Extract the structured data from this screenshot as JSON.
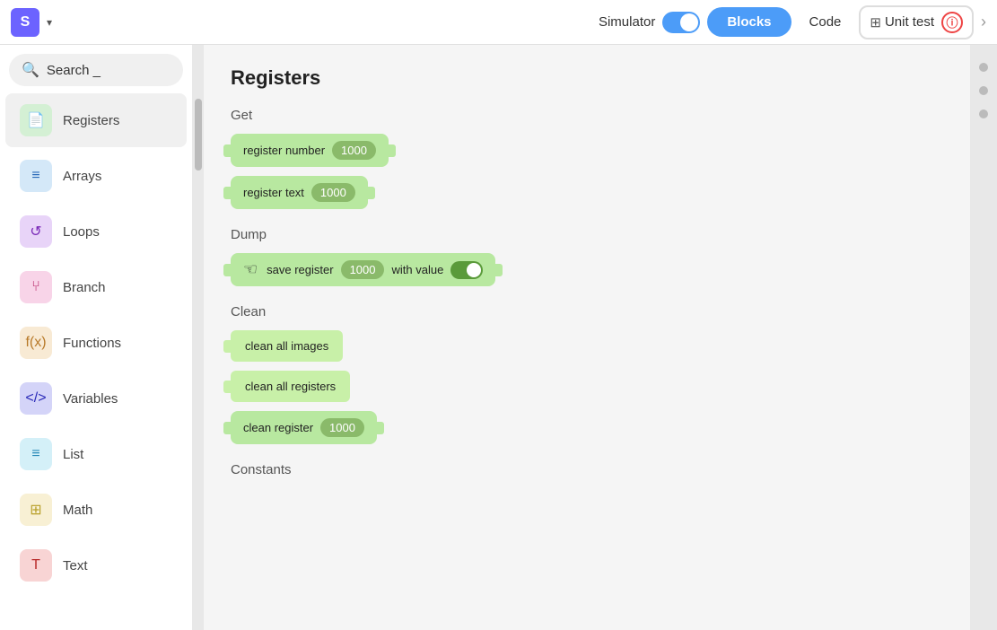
{
  "topbar": {
    "logo_text": "S",
    "chevron": "▾",
    "simulator_label": "Simulator",
    "btn_blocks_label": "Blocks",
    "btn_code_label": "Code",
    "unit_test_label": "Unit test",
    "info_symbol": "ⓘ"
  },
  "search": {
    "placeholder": "Search...",
    "value": "Search _"
  },
  "sidebar": {
    "items": [
      {
        "id": "registers",
        "label": "Registers",
        "icon": "📄",
        "icon_class": "icon-registers"
      },
      {
        "id": "arrays",
        "label": "Arrays",
        "icon": "≡",
        "icon_class": "icon-arrays"
      },
      {
        "id": "loops",
        "label": "Loops",
        "icon": "↺",
        "icon_class": "icon-loops"
      },
      {
        "id": "branch",
        "label": "Branch",
        "icon": "⑂",
        "icon_class": "icon-branch"
      },
      {
        "id": "functions",
        "label": "Functions",
        "icon": "f(x)",
        "icon_class": "icon-functions"
      },
      {
        "id": "variables",
        "label": "Variables",
        "icon": "</>",
        "icon_class": "icon-variables"
      },
      {
        "id": "list",
        "label": "List",
        "icon": "≡",
        "icon_class": "icon-list"
      },
      {
        "id": "math",
        "label": "Math",
        "icon": "⊞",
        "icon_class": "icon-math"
      },
      {
        "id": "text",
        "label": "Text",
        "icon": "T",
        "icon_class": "icon-text"
      }
    ]
  },
  "content": {
    "title": "Registers",
    "sections": [
      {
        "id": "get",
        "label": "Get",
        "blocks": [
          {
            "id": "reg-number",
            "text": "register number",
            "pill": "1000",
            "has_pill": true
          },
          {
            "id": "reg-text",
            "text": "register text",
            "pill": "1000",
            "has_pill": true
          }
        ]
      },
      {
        "id": "dump",
        "label": "Dump",
        "blocks": [
          {
            "id": "save-reg",
            "text": "save register",
            "pill": "1000",
            "has_pill": true,
            "has_toggle": true,
            "extra_text": "with value"
          }
        ]
      },
      {
        "id": "clean",
        "label": "Clean",
        "blocks": [
          {
            "id": "clean-all-images",
            "text": "clean all images",
            "has_pill": false
          },
          {
            "id": "clean-all-registers",
            "text": "clean all registers",
            "has_pill": false
          },
          {
            "id": "clean-register-000",
            "text": "clean register",
            "pill": "1000",
            "has_pill": true
          }
        ]
      },
      {
        "id": "constants",
        "label": "Constants",
        "blocks": []
      }
    ]
  }
}
